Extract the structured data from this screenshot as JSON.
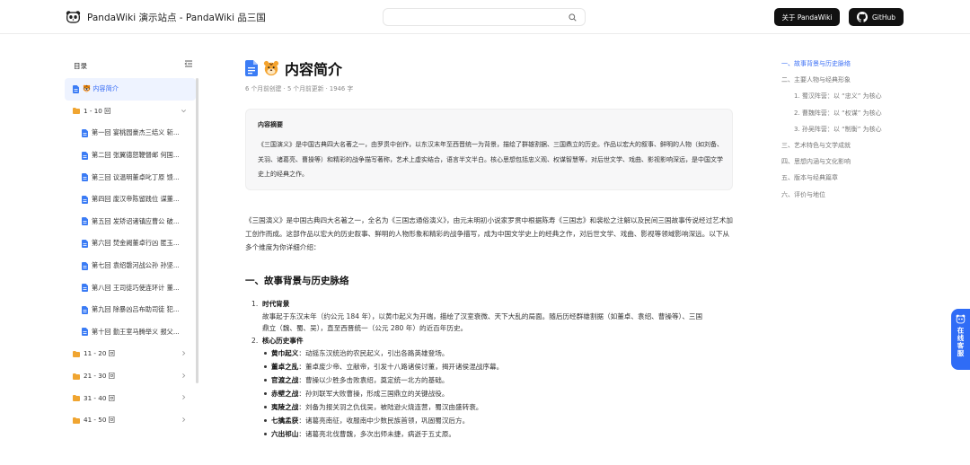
{
  "header": {
    "site_title": "PandaWiki 演示站点 - PandaWiki 品三国",
    "search_placeholder": "",
    "about_label": "关于 PandaWiki",
    "github_label": "GitHub"
  },
  "sidebar": {
    "title": "目录",
    "items": [
      {
        "label": "🐯 内容简介",
        "type": "doc",
        "level": 0,
        "active": true
      },
      {
        "label": "1 - 10 回",
        "type": "folder",
        "level": 0,
        "expanded": true
      },
      {
        "label": "第一回 宴桃园豪杰三结义 斩...",
        "type": "doc",
        "level": 1
      },
      {
        "label": "第二回 张翼德怒鞭督邮 何国...",
        "type": "doc",
        "level": 1
      },
      {
        "label": "第三回 议温明董卓叱丁原 馈...",
        "type": "doc",
        "level": 1
      },
      {
        "label": "第四回 废汉帝陈留践位 谋董...",
        "type": "doc",
        "level": 1
      },
      {
        "label": "第五回 发矫诏诸镇应曹公 破...",
        "type": "doc",
        "level": 1
      },
      {
        "label": "第六回 焚金阙董卓行凶 匿玉...",
        "type": "doc",
        "level": 1
      },
      {
        "label": "第七回 袁绍磐河战公孙 孙坚...",
        "type": "doc",
        "level": 1
      },
      {
        "label": "第八回 王司徒巧使连环计 董...",
        "type": "doc",
        "level": 1
      },
      {
        "label": "第九回 除暴凶吕布助司徒 犯...",
        "type": "doc",
        "level": 1
      },
      {
        "label": "第十回 勤王室马腾举义 报父...",
        "type": "doc",
        "level": 1
      },
      {
        "label": "11 - 20 回",
        "type": "folder",
        "level": 0,
        "expanded": false
      },
      {
        "label": "21 - 30 回",
        "type": "folder",
        "level": 0,
        "expanded": false
      },
      {
        "label": "31 - 40 回",
        "type": "folder",
        "level": 0,
        "expanded": false
      },
      {
        "label": "41 - 50 回",
        "type": "folder",
        "level": 0,
        "expanded": false
      }
    ]
  },
  "main": {
    "title": "内容简介",
    "meta": "6 个月前创建 · 5 个月前更新 · 1946 字",
    "summary_title": "内容摘要",
    "summary_text": "《三国演义》是中国古典四大名著之一，由罗贯中创作，以东汉末年至西晋统一为背景，描绘了群雄割据、三国鼎立的历史。作品以宏大的叙事、鲜明的人物（如刘备、关羽、诸葛亮、曹操等）和精彩的战争描写著称，艺术上虚实结合，语言半文半白。核心思想包括忠义观、权谋智慧等，对后世文学、戏曲、影视影响深远，是中国文学史上的经典之作。",
    "intro": "《三国演义》是中国古典四大名著之一，全名为《三国志通俗演义》，由元末明初小说家罗贯中根据陈寿《三国志》和裴松之注解以及民间三国故事传说经过艺术加工创作而成。这部作品以宏大的历史叙事、鲜明的人物形象和精彩的战争描写，成为中国文学史上的经典之作，对后世文学、戏曲、影视等领域影响深远。以下从多个维度为你详细介绍：",
    "section1_title": "一、故事背景与历史脉络",
    "list": [
      {
        "num": "1.",
        "title": "时代背景",
        "text": "故事起于东汉末年（约公元 184 年），以黄巾起义为开端，描绘了汉室衰微、天下大乱的局面。随后历经群雄割据（如董卓、袁绍、曹操等）、三国鼎立（魏、蜀、吴），直至西晋统一（公元 280 年）的近百年历史。"
      },
      {
        "num": "2.",
        "title": "核心历史事件",
        "bullets": [
          {
            "term": "黄巾起义",
            "desc": "：动摇东汉统治的农民起义，引出各路英雄登场。"
          },
          {
            "term": "董卓之乱",
            "desc": "：董卓废少帝、立献帝，引发十八路诸侯讨董，揭开诸侯混战序幕。"
          },
          {
            "term": "官渡之战",
            "desc": "：曹操以少胜多击败袁绍，奠定统一北方的基础。"
          },
          {
            "term": "赤壁之战",
            "desc": "：孙刘联军大败曹操，形成三国鼎立的关键战役。"
          },
          {
            "term": "夷陵之战",
            "desc": "：刘备为报关羽之仇伐吴，被陆逊火烧连营，蜀汉由盛转衰。"
          },
          {
            "term": "七擒孟获",
            "desc": "：诸葛亮南征，收服南中少数民族首领，巩固蜀汉后方。"
          },
          {
            "term": "六出祁山",
            "desc": "：诸葛亮北伐曹魏，多次出师未捷，病逝于五丈原。"
          }
        ]
      }
    ]
  },
  "right_toc": [
    {
      "label": "一、故事背景与历史脉络",
      "sub": false,
      "active": true
    },
    {
      "label": "二、主要人物与经典形象",
      "sub": false,
      "active": false
    },
    {
      "label": "1. 蜀汉阵营：以 “忠义” 为核心",
      "sub": true,
      "active": false
    },
    {
      "label": "2. 曹魏阵营：以 “权谋” 为核心",
      "sub": true,
      "active": false
    },
    {
      "label": "3. 孙吴阵营：以 “制衡” 为核心",
      "sub": true,
      "active": false
    },
    {
      "label": "三、艺术特色与文学成就",
      "sub": false,
      "active": false
    },
    {
      "label": "四、思想内涵与文化影响",
      "sub": false,
      "active": false
    },
    {
      "label": "五、版本与经典篇章",
      "sub": false,
      "active": false
    },
    {
      "label": "六、评价与地位",
      "sub": false,
      "active": false
    }
  ],
  "floating": {
    "label": "在线客服"
  },
  "colors": {
    "accent": "#3b6ff5",
    "dark_button": "#111111",
    "float_bg": "#2f6cf6",
    "folder": "#f0a531"
  }
}
